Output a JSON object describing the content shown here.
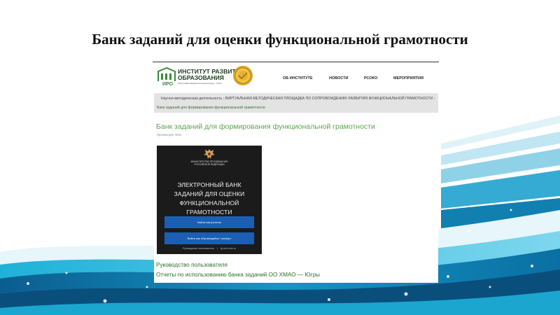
{
  "slide": {
    "title": "Банк заданий для оценки функциональной грамотности",
    "accent_colors": [
      "#0a6fa0",
      "#18a3cc",
      "#7fd3ea",
      "#e6f6fb"
    ]
  },
  "site": {
    "logo": {
      "line1": "ИНСТИТУТ РАЗВИТИЯ",
      "line2": "ОБРАЗОВАНИЯ",
      "abbr": "ИРО",
      "subtitle": "Ханты-Мансийский автономный округ - Югра"
    },
    "nav": [
      "ОБ ИНСТИТУТЕ",
      "НОВОСТИ",
      "РСОКО",
      "МЕРОПРИЯТИЯ"
    ],
    "breadcrumbs": [
      "Научно-методическая деятельность",
      "ВИРТУАЛЬНАЯ МЕТОДИЧЕСКАЯ ПЛОЩАДКА ПО СОПРОВОЖДЕНИЮ РАЗВИТИЯ ФУНКЦИОНАЛЬНОЙ ГРАМОТНОСТИ",
      "Банк заданий для формирования функциональной грамотности"
    ],
    "breadcrumb_separator": "›",
    "page_heading": "Банк заданий для формирования функциональной грамотности",
    "views": "Просмотров: 4541"
  },
  "promo": {
    "ministry": [
      "МИНИСТЕРСТВО ПРОСВЕЩЕНИЯ",
      "РОССИЙСКОЙ ФЕДЕРАЦИИ"
    ],
    "title": [
      "ЭЛЕКТРОННЫЙ БАНК",
      "ЗАДАНИЙ ДЛЯ ОЦЕНКИ",
      "ФУНКЦИОНАЛЬНОЙ ГРАМОТНОСТИ"
    ],
    "button_teacher": "Войти как учитель",
    "button_student": "Войти как обучающийся / эксперт",
    "footer_guide": "Руководство пользователя",
    "footer_site": "fg.resh.edu.ru",
    "footer_separator": "|"
  },
  "links": [
    "Руководство пользователя",
    "Отчеты по использованию банка заданий ОО ХМАО — Югры"
  ]
}
